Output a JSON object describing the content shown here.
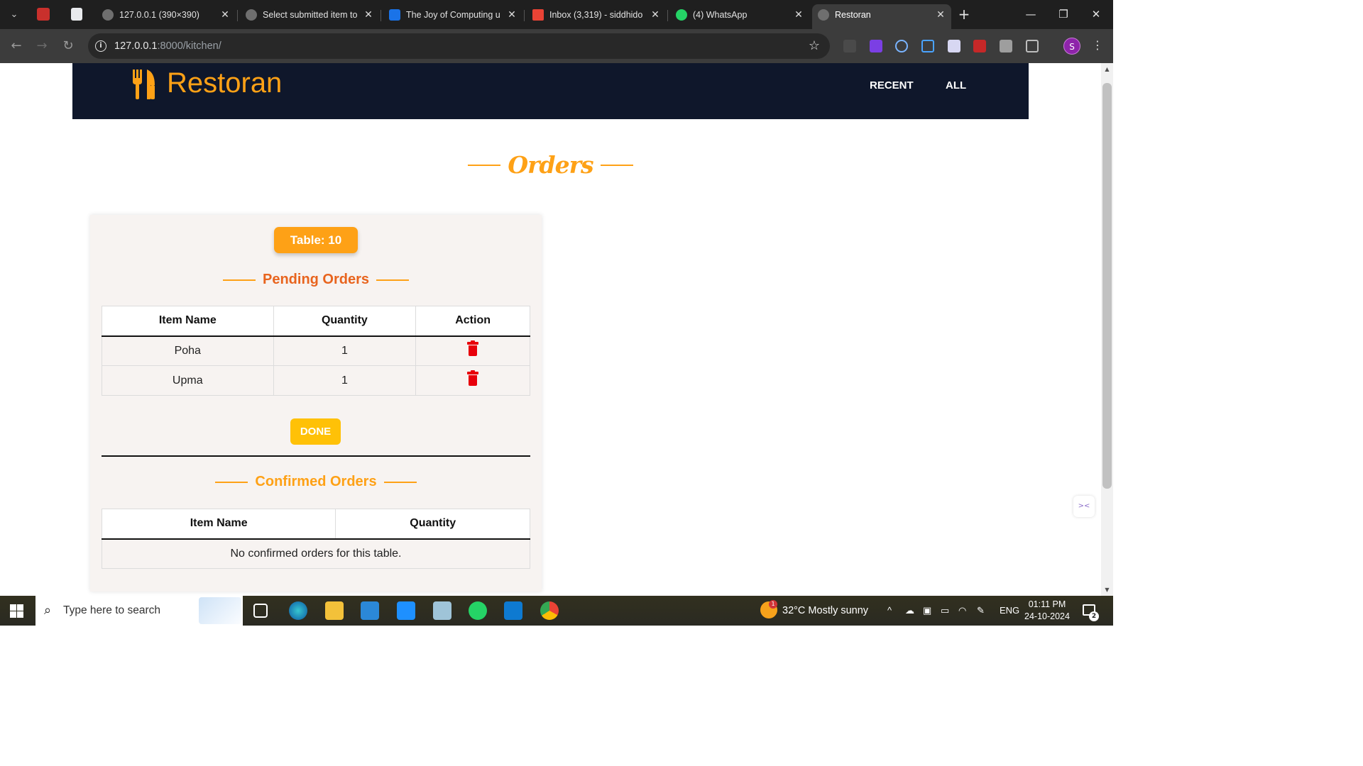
{
  "browser": {
    "tabs": [
      {
        "title": "127.0.0.1 (390×390)",
        "active": false
      },
      {
        "title": "Select submitted item to",
        "active": false
      },
      {
        "title": "The Joy of Computing u",
        "active": false
      },
      {
        "title": "Inbox (3,319) - siddhido",
        "active": false
      },
      {
        "title": "(4) WhatsApp",
        "active": false
      },
      {
        "title": "Restoran",
        "active": true
      }
    ],
    "close_glyph": "✕",
    "new_tab_glyph": "+",
    "url_host": "127.0.0.1",
    "url_path": ":8000/kitchen/",
    "profile_initial": "S"
  },
  "site": {
    "brand": "Restoran",
    "nav": [
      "RECENT",
      "ALL"
    ],
    "page_title": "Orders"
  },
  "order_card": {
    "table_badge": "Table: 10",
    "pending_title": "Pending Orders",
    "pending_columns": [
      "Item Name",
      "Quantity",
      "Action"
    ],
    "pending_rows": [
      {
        "item": "Poha",
        "quantity": "1",
        "action_icon": "trash-icon"
      },
      {
        "item": "Upma",
        "quantity": "1",
        "action_icon": "trash-icon"
      }
    ],
    "done_label": "DONE",
    "confirmed_title": "Confirmed Orders",
    "confirmed_columns": [
      "Item Name",
      "Quantity"
    ],
    "confirmed_empty": "No confirmed orders for this table."
  },
  "taskbar": {
    "search_placeholder": "Type here to search",
    "weather_badge": "1",
    "weather": "32°C  Mostly sunny",
    "language": "ENG",
    "time": "01:11 PM",
    "date": "24-10-2024",
    "notification_count": "2"
  },
  "colors": {
    "accent": "#fea116",
    "header_bg": "#0f172b",
    "delete": "#e8000b",
    "done": "#ffc107",
    "pending_title": "#e8641e"
  }
}
